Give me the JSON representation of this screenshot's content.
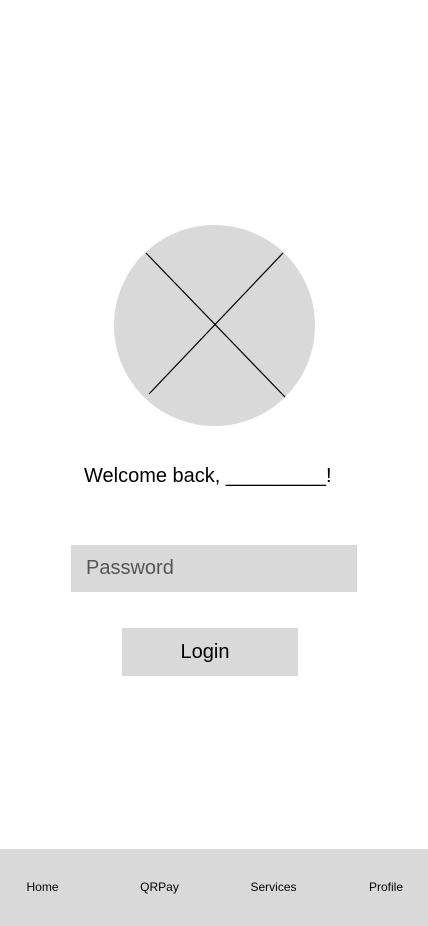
{
  "avatar": {
    "icon": "image-placeholder-icon",
    "fill": "#d9d9d9"
  },
  "welcome": {
    "text": "Welcome back,  _________!"
  },
  "login_form": {
    "password_placeholder": "Password",
    "login_label": "Login"
  },
  "tab_bar": {
    "tabs": [
      {
        "label": "Home"
      },
      {
        "label": "QRPay"
      },
      {
        "label": "Services"
      },
      {
        "label": "Profile"
      }
    ]
  },
  "colors": {
    "placeholder_gray": "#d9d9d9",
    "background": "#ffffff"
  }
}
